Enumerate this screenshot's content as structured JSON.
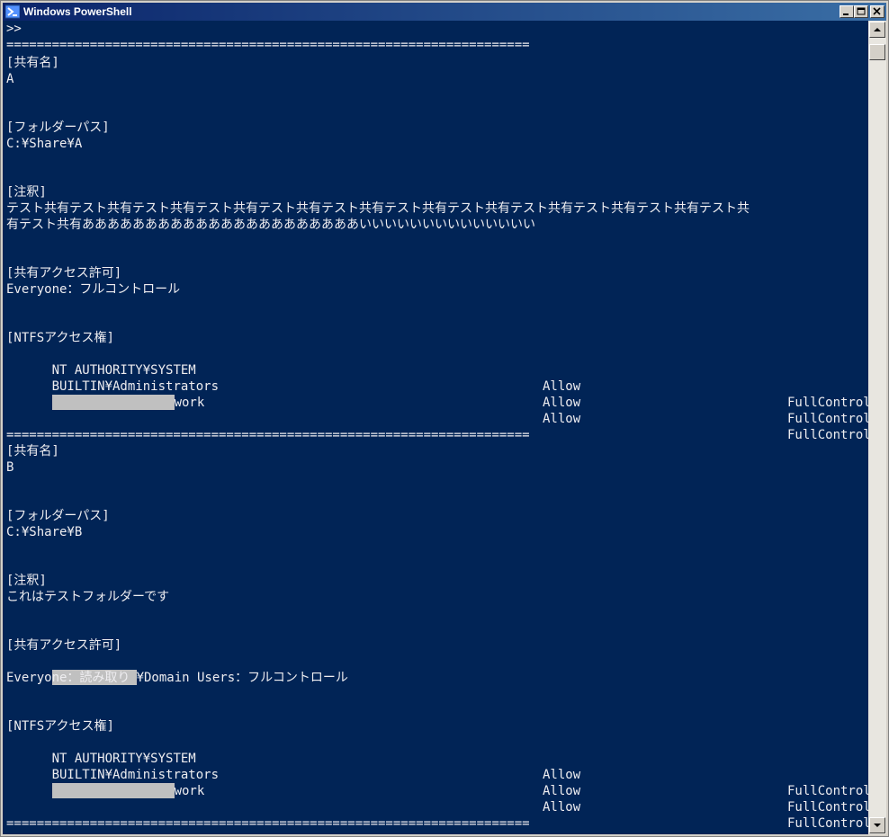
{
  "window": {
    "title": "Windows PowerShell"
  },
  "colors": {
    "console_bg": "#012456",
    "console_fg": "#eeedf0",
    "titlebar_start": "#0a246a",
    "titlebar_end": "#3a6ea5",
    "redaction": "#c0c0c0"
  },
  "icons": {
    "app": "powershell-icon",
    "minimize": "minimize-icon",
    "maximize": "maximize-icon",
    "close": "close-icon",
    "scroll_up": "arrow-up-icon",
    "scroll_down": "arrow-down-icon"
  },
  "console": {
    "prompt": ">>",
    "separator": "=====================================================================",
    "labels": {
      "share_name": "[共有名]",
      "folder_path": "[フォルダーパス]",
      "comment": "[注釈]",
      "share_access": "[共有アクセス許可]",
      "ntfs_access": "[NTFSアクセス権]"
    },
    "shares": [
      {
        "name": "A",
        "path": "C:¥Share¥A",
        "comment_lines": [
          "テスト共有テスト共有テスト共有テスト共有テスト共有テスト共有テスト共有テスト共有テスト共有テスト共有テスト共有テスト共",
          "有テスト共有ああああああああああああああああああああああいいいいいいいいいいいいいい"
        ],
        "share_access": [
          "Everyone：フルコントロール"
        ],
        "ntfs": [
          {
            "identity": "NT AUTHORITY¥SYSTEM",
            "type": "Allow",
            "rights": "FullControl"
          },
          {
            "identity": "BUILTIN¥Administrators",
            "type": "Allow",
            "rights": "FullControl"
          },
          {
            "identity": "work",
            "type": "Allow",
            "rights": "FullControl"
          }
        ]
      },
      {
        "name": "B",
        "path": "C:¥Share¥B",
        "comment_lines": [
          "これはテストフォルダーです"
        ],
        "share_access": [
          "¥Domain Users：フルコントロール",
          "Everyone：読み取り"
        ],
        "ntfs": [
          {
            "identity": "NT AUTHORITY¥SYSTEM",
            "type": "Allow",
            "rights": "FullControl"
          },
          {
            "identity": "BUILTIN¥Administrators",
            "type": "Allow",
            "rights": "FullControl"
          },
          {
            "identity": "work",
            "type": "Allow",
            "rights": "FullControl"
          }
        ]
      }
    ]
  }
}
